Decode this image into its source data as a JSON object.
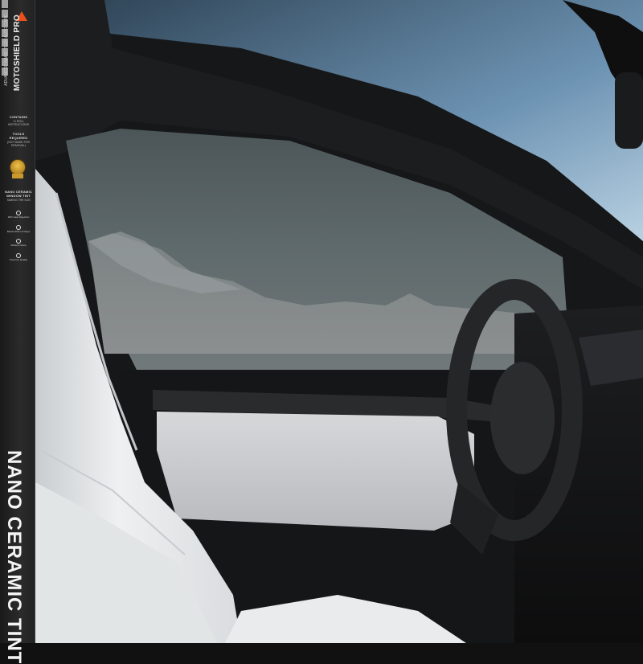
{
  "product_strip": {
    "brand_name": "MOTOSHIELD PRO",
    "brand_tagline": "ADVANCED NANO-TECH AUTO CARE",
    "contains_title": "CONTAINS",
    "contains_sub": "+1 ROLL INSTRUCTIONS",
    "tools_title": "TOOLS REQUIRED",
    "tools_sub": "(NOT MADE FOR REMOVAL)",
    "product_type": "NANO CERAMIC WINDOW TINT",
    "product_type_sub": "TAMING THE SUN",
    "features": [
      "99% Heat Rejection",
      "Blocks 99% UV Rays",
      "Reflects Glare",
      "Premium Quality"
    ],
    "big_title": "NANO CERAMIC TINT"
  },
  "colors": {
    "brand_accent": "#e8501e",
    "seat_leather": "#eceeef",
    "sky": "#7fa6c4"
  },
  "icons": [
    "brand-logo-icon",
    "award-badge-icon",
    "feature-icon"
  ]
}
